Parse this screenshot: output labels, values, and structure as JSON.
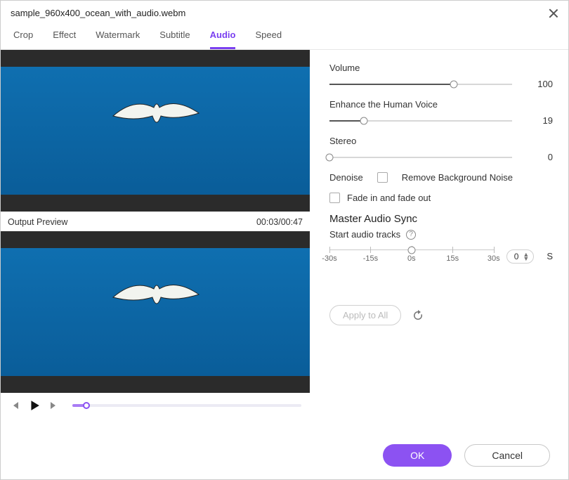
{
  "window": {
    "title": "sample_960x400_ocean_with_audio.webm"
  },
  "tabs": {
    "items": [
      "Crop",
      "Effect",
      "Watermark",
      "Subtitle",
      "Audio",
      "Speed"
    ],
    "active_index": 4
  },
  "preview": {
    "label": "Output Preview",
    "time": "00:03/00:47",
    "progress_pct": 6
  },
  "audio": {
    "volume": {
      "label": "Volume",
      "value": 100,
      "pct": 68
    },
    "enhance": {
      "label": "Enhance the Human Voice",
      "value": 19,
      "pct": 19
    },
    "stereo": {
      "label": "Stereo",
      "value": 0,
      "pct": 0
    },
    "denoise": {
      "label": "Denoise",
      "remove_label": "Remove Background Noise",
      "checked": false
    },
    "fade": {
      "label": "Fade in and fade out",
      "checked": false
    },
    "master": {
      "title": "Master Audio Sync",
      "subtitle": "Start audio tracks",
      "ticks": [
        "-30s",
        "-15s",
        "0s",
        "15s",
        "30s"
      ],
      "value": 0,
      "unit": "S"
    },
    "apply_label": "Apply to All"
  },
  "footer": {
    "ok": "OK",
    "cancel": "Cancel"
  }
}
